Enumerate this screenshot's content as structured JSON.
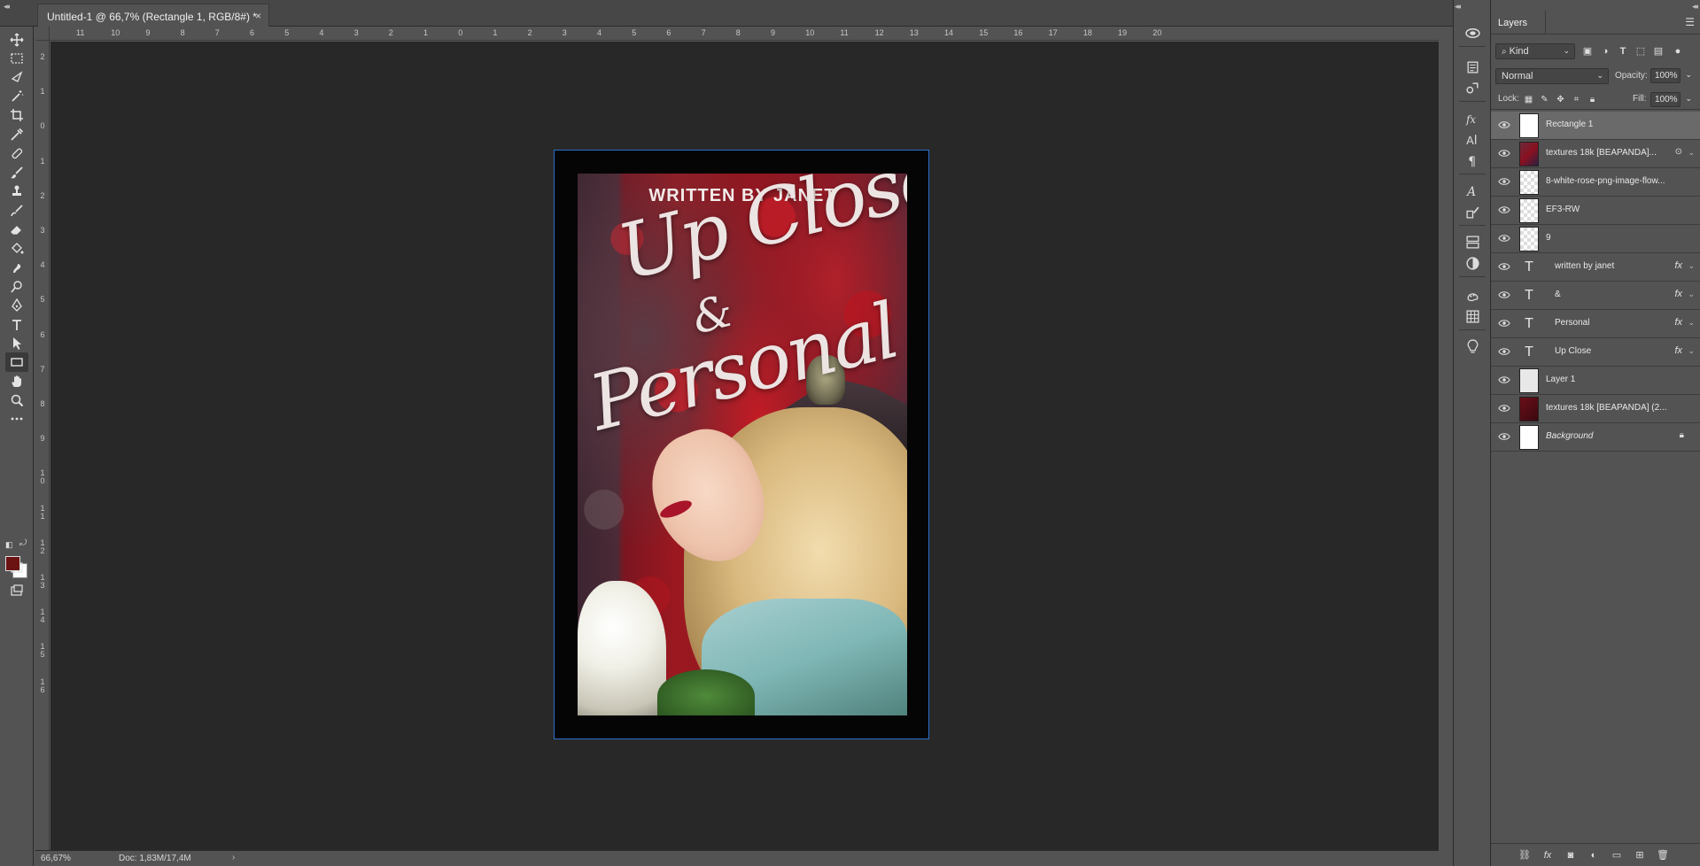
{
  "document": {
    "tab_title": "Untitled-1 @ 66,7% (Rectangle 1, RGB/8#) *",
    "close_glyph": "×"
  },
  "rulers": {
    "top_labels": [
      "11",
      "10",
      "9",
      "8",
      "7",
      "6",
      "5",
      "4",
      "3",
      "2",
      "1",
      "0",
      "1",
      "2",
      "3",
      "4",
      "5",
      "6",
      "7",
      "8",
      "9",
      "10",
      "11",
      "12",
      "13",
      "14",
      "15",
      "16",
      "17",
      "18",
      "19",
      "20"
    ],
    "left_labels": [
      "2",
      "1",
      "0",
      "1",
      "2",
      "3",
      "4",
      "5",
      "6",
      "7",
      "8",
      "9",
      "10",
      "11",
      "12",
      "13",
      "14",
      "15",
      "16"
    ]
  },
  "cover": {
    "subtitle": "WRITTEN BY JANET",
    "title_line1": "Up Close",
    "title_amp": "&",
    "title_line2": "Personal"
  },
  "colors": {
    "foreground": "#6b1212",
    "background": "#ffffff",
    "selection_border": "#2a6fc9"
  },
  "status": {
    "zoom": "66,67%",
    "doc": "Doc: 1,83M/17,4M",
    "arrow": "›"
  },
  "tools": [
    "move-icon",
    "marquee-icon",
    "lasso-icon",
    "magic-wand-icon",
    "crop-icon",
    "eyedropper-icon",
    "healing-icon",
    "brush-icon",
    "stamp-icon",
    "history-brush-icon",
    "eraser-icon",
    "paint-bucket-icon",
    "smudge-icon",
    "dodge-icon",
    "pen-icon",
    "type-icon",
    "path-select-icon",
    "rectangle-icon",
    "hand-icon",
    "zoom-icon",
    "more-icon"
  ],
  "layers_panel": {
    "tab": "Layers",
    "filter_kind": "Kind",
    "blend_mode": "Normal",
    "opacity_label": "Opacity:",
    "opacity_value": "100%",
    "lock_label": "Lock:",
    "fill_label": "Fill:",
    "fill_value": "100%",
    "layers": [
      {
        "name": "Rectangle 1",
        "type": "shape",
        "selected": true,
        "fx": false
      },
      {
        "name": "textures 18k [BEAPANDA]...",
        "type": "smart",
        "selected": false,
        "fx": false
      },
      {
        "name": "8-white-rose-png-image-flow...",
        "type": "smart",
        "selected": false,
        "fx": false
      },
      {
        "name": "EF3-RW",
        "type": "smart",
        "selected": false,
        "fx": false
      },
      {
        "name": "9",
        "type": "smart",
        "selected": false,
        "fx": false
      },
      {
        "name": "written by janet",
        "type": "text",
        "selected": false,
        "fx": true
      },
      {
        "name": "&",
        "type": "text",
        "selected": false,
        "fx": true
      },
      {
        "name": "Personal",
        "type": "text",
        "selected": false,
        "fx": true
      },
      {
        "name": "Up Close",
        "type": "text",
        "selected": false,
        "fx": true
      },
      {
        "name": "Layer 1",
        "type": "pixel",
        "selected": false,
        "fx": false
      },
      {
        "name": "textures 18k [BEAPANDA] (2...",
        "type": "pixel",
        "selected": false,
        "fx": false
      },
      {
        "name": "Background",
        "type": "background",
        "selected": false,
        "fx": false
      }
    ],
    "fx_label": "fx",
    "type_glyph": "T"
  }
}
